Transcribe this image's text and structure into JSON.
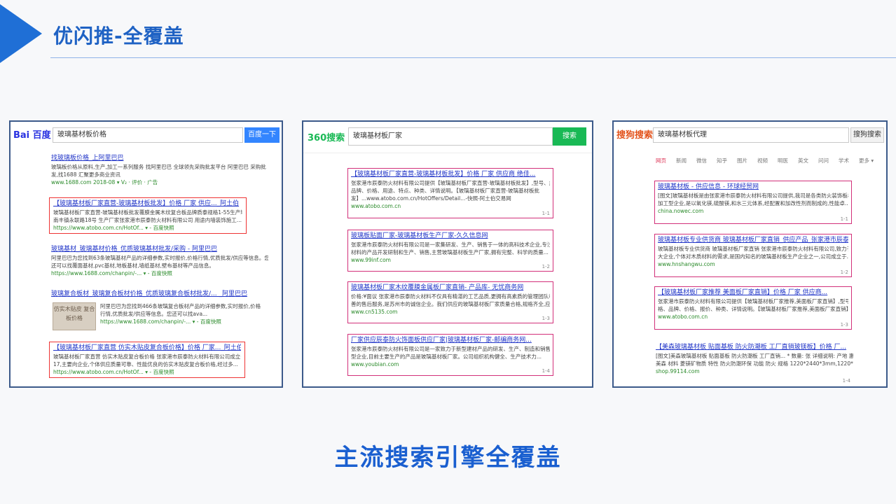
{
  "header": {
    "title": "优闪推-全覆盖"
  },
  "footer": {
    "title": "主流搜索引擎全覆盖"
  },
  "baidu": {
    "logo": "Bai 百度",
    "query": "玻璃基材板价格",
    "button": "百度一下",
    "results": [
      {
        "title": "找玻璃板价格_上阿里巴巴",
        "desc1": "玻璃板价格从原料,生产,加工一系列服务 找阿里巴巴 全球领先采购批发平台 阿里巴巴 采购批",
        "desc2": "发,找1688 汇聚更多商业资讯",
        "url": "www.1688.com  2018-08  ▾ V₂ · 评价 · 广告"
      },
      {
        "title": "【玻璃基材板厂家直营-玻璃基材板批发】价格 厂家 供应..._阿土伯",
        "desc1": "玻璃基材板厂家直营-玻璃基材板批发覆膜金属木纹复合板品牌质泰规格1-55生产地址张家港市",
        "desc2": "南丰镇永联路18号 生产厂家张家港市辰泰防火材料有限公司 用途内墙装饰施工...",
        "url": "https://www.atobo.com.cn/HotOf...  ▾ - 百度快照"
      },
      {
        "title": "玻璃基材_玻璃基材价格_优质玻璃基材批发/采购 - 阿里巴巴",
        "desc1": "阿里巴巴为您找到63条玻璃基材产品的详细参数,实时报价,价格行情,优质批发/供应等信息。您",
        "desc2": "还可以找覆面基材,pvc基材,地板基材,墙纸基材,壁布基材等产品信息。",
        "url": "https://www.1688.com/chanpin/-...  ▾ - 百度快照"
      },
      {
        "title": "玻璃复合板材_玻璃复合板材价格_优质玻璃复合板材批发/... _阿里巴巴",
        "desc1": "阿里巴巴为您找到466条玻璃复合板材产品的详细参数,实时报价,价格",
        "desc2": "行情,优质批发/供应等信息。您还可以找ava...",
        "url": "https://www.1688.com/chanpin/-...  ▾ - 百度快照"
      },
      {
        "title": "【玻璃基材板厂家直营 仿实木贴皮复合板价格】价格 厂家..._阿土伯",
        "desc1": "玻璃基材板厂家直营 仿实木贴皮复合板价格 张家港市辰泰防火材料有限公司成立于2017-07-",
        "desc2": "17,主要向企业,个体供应质量可靠、性能优良的仿实木贴皮复合板价格,经过多...",
        "url": "https://www.atobo.com.cn/HotOf...  ▾ - 百度快照"
      }
    ],
    "thumb_text": "仿实木贴皮 复合板价格"
  },
  "s360": {
    "logo": "360搜索",
    "query": "玻璃基材板厂家",
    "button": "搜索",
    "results": [
      {
        "title": "【玻璃基材板厂家直营-玻璃基材板批发】价格 厂家 供应商 绝佳...",
        "desc1": "张家港市辰泰防火材料有限公司提供【玻璃基材板厂家直营-玻璃基材板批发】,型号、规格、",
        "desc2": "品牌、价格、用途、特点、种类、详情说明。【玻璃基材板厂家直营-玻璃基材板批",
        "desc3": "发】...www.atobo.com.cn/HotOffers/Detail...-快照-阿土伯交易网",
        "url": "www.atobo.com.cn",
        "idx": "1-1"
      },
      {
        "title": "玻璃板贴面厂家-玻璃基材板生产厂家-久久信息网",
        "desc1": "张家港市辰泰防火材料有限公司是一家集研发、生产、销售于一体的高科技术企业,专注木质",
        "desc2": "材料的产品开发研制和生产、销售,主营玻璃基材板生产厂家,拥有完整、科学的质量...",
        "url": "www.99inf.com",
        "idx": "1-2"
      },
      {
        "title": "玻璃基材板厂家木纹覆膜金属板厂家直销- 产品库- 无忧商务网",
        "desc1": "价格:¥面议 张家港市辰泰防火材料不仅具有精湛的工艺品质,更拥有高素质的管理团队和完",
        "desc2": "善的售后服务,是苏州市的诚信企业。我们供应的玻璃基材板厂家质量合格,规格齐全,应用范...",
        "url": "www.cn5135.com",
        "idx": "1-3"
      },
      {
        "title": "厂家供应辰泰防火饰面板供应厂家|玻璃基材板厂家-邮编商务网...",
        "desc1": "张家港市辰泰防火材料有限公司是一家致力于新型建材产品的研发、生产、制造和销售的生产",
        "desc2": "型企业,目前主要生产的产品是玻璃基材板厂家。公司组织机构健全、生产技术力...",
        "url": "www.youbian.com",
        "idx": "1-4"
      }
    ]
  },
  "sogou": {
    "logo": "搜狗搜索",
    "query": "玻璃基材板代理",
    "button": "搜狗搜索",
    "tabs": [
      "网页",
      "新闻",
      "微信",
      "知乎",
      "图片",
      "视频",
      "明医",
      "英文",
      "问问",
      "学术",
      "更多 ▾"
    ],
    "results": [
      {
        "title": "玻璃基材板 - 供应信息 - 环球经贸网",
        "desc1": "[图文]玻璃基材板是由张家港市辰泰防火材料有限公司提供,我司是各类防火装饰板材的生产",
        "desc2": "加工型企业,是以氧化镁,硫酸镁,和水三元体系,经配置和加改性剂而制成的,性能卓...",
        "url": "china.nowec.com",
        "idx": "1-1"
      },
      {
        "title": "玻璃基材板专业供货商 玻璃基材板厂家直销_供应产品_张家港市辰泰...",
        "desc1": "玻璃基材板专业供货商 玻璃基材板厂家直销 张家港市辰泰防火材料有限公司,致力于满足广",
        "desc2": "大企业,个体对木质材料的需求,是国内知名的玻璃基材板生产企业之一,公司成立于...",
        "url": "www.hnshangwu.com",
        "idx": "1-2"
      },
      {
        "title": "【玻璃基材板厂家推荐 美面板厂家直销】价格 厂家 供应商...",
        "desc1": "张家港市辰泰防火材料有限公司提供【玻璃基材板厂家推荐,美面板厂家直销】,型号、规",
        "desc2": "格、品牌、价格、报价、种类、详情说明。【玻璃基材板厂家推荐,美面板厂家直销】在...",
        "url": "www.atobo.com.cn",
        "idx": "1-3"
      },
      {
        "title": "【美森玻璃基材板 贴面基板 防火防潮板 工厂直销玻镁板】价格 厂...",
        "desc1": "[图文]美森玻璃基材板 贴面基板 防火防潮板 工厂直销... * 数量: 张 详细说明: 产地 惠州 品牌",
        "desc2": "美森 材料 菱镁矿物质 特性 防火防潮环保 功能 防火 规格 1220*2440*3mm,1220*2440*...",
        "url": "shop.99114.com",
        "idx": "1-4"
      }
    ]
  }
}
